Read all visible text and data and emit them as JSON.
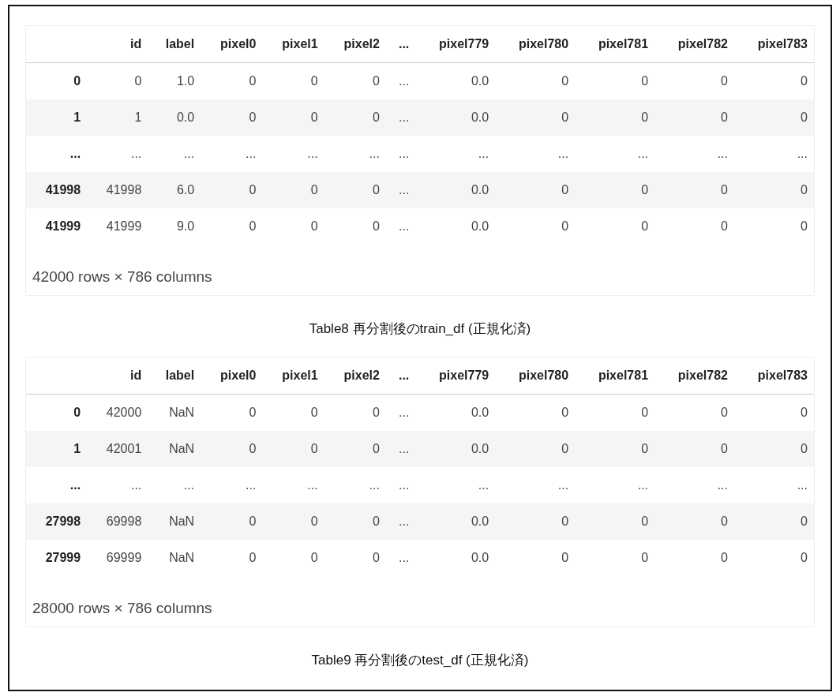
{
  "tables": [
    {
      "columns": [
        "id",
        "label",
        "pixel0",
        "pixel1",
        "pixel2",
        "...",
        "pixel779",
        "pixel780",
        "pixel781",
        "pixel782",
        "pixel783"
      ],
      "rows": [
        {
          "index": "0",
          "cells": [
            "0",
            "1.0",
            "0",
            "0",
            "0",
            "...",
            "0.0",
            "0",
            "0",
            "0",
            "0"
          ]
        },
        {
          "index": "1",
          "cells": [
            "1",
            "0.0",
            "0",
            "0",
            "0",
            "...",
            "0.0",
            "0",
            "0",
            "0",
            "0"
          ]
        },
        {
          "index": "...",
          "cells": [
            "...",
            "...",
            "...",
            "...",
            "...",
            "...",
            "...",
            "...",
            "...",
            "...",
            "..."
          ]
        },
        {
          "index": "41998",
          "cells": [
            "41998",
            "6.0",
            "0",
            "0",
            "0",
            "...",
            "0.0",
            "0",
            "0",
            "0",
            "0"
          ]
        },
        {
          "index": "41999",
          "cells": [
            "41999",
            "9.0",
            "0",
            "0",
            "0",
            "...",
            "0.0",
            "0",
            "0",
            "0",
            "0"
          ]
        }
      ],
      "shape": "42000 rows × 786 columns",
      "caption": "Table8 再分割後のtrain_df (正規化済)"
    },
    {
      "columns": [
        "id",
        "label",
        "pixel0",
        "pixel1",
        "pixel2",
        "...",
        "pixel779",
        "pixel780",
        "pixel781",
        "pixel782",
        "pixel783"
      ],
      "rows": [
        {
          "index": "0",
          "cells": [
            "42000",
            "NaN",
            "0",
            "0",
            "0",
            "...",
            "0.0",
            "0",
            "0",
            "0",
            "0"
          ]
        },
        {
          "index": "1",
          "cells": [
            "42001",
            "NaN",
            "0",
            "0",
            "0",
            "...",
            "0.0",
            "0",
            "0",
            "0",
            "0"
          ]
        },
        {
          "index": "...",
          "cells": [
            "...",
            "...",
            "...",
            "...",
            "...",
            "...",
            "...",
            "...",
            "...",
            "...",
            "..."
          ]
        },
        {
          "index": "27998",
          "cells": [
            "69998",
            "NaN",
            "0",
            "0",
            "0",
            "...",
            "0.0",
            "0",
            "0",
            "0",
            "0"
          ]
        },
        {
          "index": "27999",
          "cells": [
            "69999",
            "NaN",
            "0",
            "0",
            "0",
            "...",
            "0.0",
            "0",
            "0",
            "0",
            "0"
          ]
        }
      ],
      "shape": "28000 rows × 786 columns",
      "caption": "Table9 再分割後のtest_df (正規化済)"
    }
  ]
}
